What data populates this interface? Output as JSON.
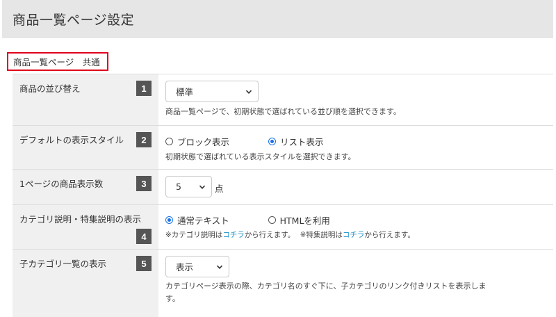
{
  "page": {
    "title": "商品一覧ページ設定"
  },
  "section": {
    "label": "商品一覧ページ　共通"
  },
  "rows": [
    {
      "num": "1",
      "label": "商品の並び替え",
      "select_value": "標準",
      "help": "商品一覧ページで、初期状態で選ばれている並び順を選択できます。"
    },
    {
      "num": "2",
      "label": "デフォルトの表示スタイル",
      "options": [
        "ブロック表示",
        "リスト表示"
      ],
      "selected": "リスト表示",
      "help": "初期状態で選ばれている表示スタイルを選択できます。"
    },
    {
      "num": "3",
      "label": "1ページの商品表示数",
      "select_value": "5",
      "unit": "点"
    },
    {
      "num": "4",
      "label": "カテゴリ説明・特集説明の表示",
      "options": [
        "通常テキスト",
        "HTMLを利用"
      ],
      "selected": "通常テキスト",
      "help_parts": {
        "a": "※カテゴリ説明は",
        "link1": "コチラ",
        "b": "から行えます。",
        "c": "※特集説明は",
        "link2": "コチラ",
        "d": "から行えます。"
      }
    },
    {
      "num": "5",
      "label": "子カテゴリ一覧の表示",
      "select_value": "表示",
      "help": "カテゴリページ表示の際、カテゴリ名のすぐ下に、子カテゴリのリンク付きリストを表示しま",
      "help2": "す。"
    }
  ],
  "colors": {
    "accent_red": "#e0001a",
    "link": "#1a8fc9",
    "radio": "#1a73e8",
    "badge": "#555555"
  }
}
